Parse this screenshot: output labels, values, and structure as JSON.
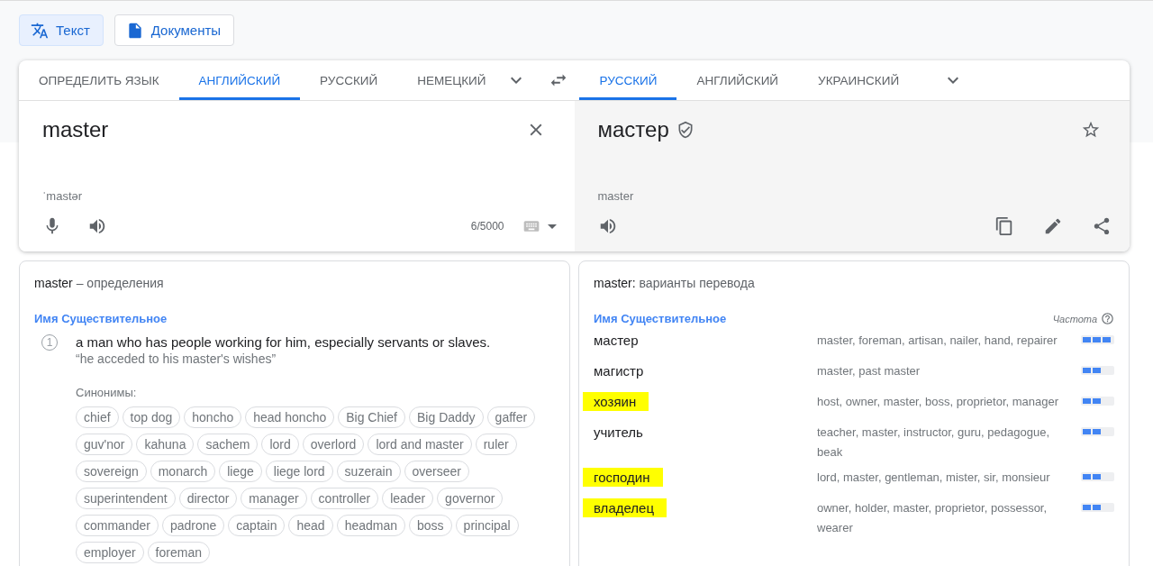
{
  "mode_buttons": [
    {
      "label": "Текст",
      "kind": "text",
      "selected": true
    },
    {
      "label": "Документы",
      "kind": "document",
      "selected": false
    }
  ],
  "source_tabs": [
    {
      "label": "ОПРЕДЕЛИТЬ ЯЗЫК",
      "selected": false
    },
    {
      "label": "АНГЛИЙСКИЙ",
      "selected": true
    },
    {
      "label": "РУССКИЙ",
      "selected": false
    },
    {
      "label": "НЕМЕЦКИЙ",
      "selected": false
    }
  ],
  "target_tabs": [
    {
      "label": "РУССКИЙ",
      "selected": true
    },
    {
      "label": "АНГЛИЙСКИЙ",
      "selected": false
    },
    {
      "label": "УКРАИНСКИЙ",
      "selected": false
    }
  ],
  "source": {
    "value": "master",
    "transcription": "ˈmastər",
    "char_count": "6/5000"
  },
  "target": {
    "value": "мастер",
    "transliteration": "master"
  },
  "definitions": {
    "word": "master",
    "title": " – определения",
    "part_of_speech": "Имя Существительное",
    "items": [
      {
        "number": "1",
        "text": "a man who has people working for him, especially servants or slaves.",
        "example": "“he acceded to his master's wishes”",
        "synonyms_label": "Синонимы:",
        "synonyms": [
          "chief",
          "top dog",
          "honcho",
          "head honcho",
          "Big Chief",
          "Big Daddy",
          "gaffer",
          "guv'nor",
          "kahuna",
          "sachem",
          "lord",
          "overlord",
          "lord and master",
          "ruler",
          "sovereign",
          "monarch",
          "liege",
          "liege lord",
          "suzerain",
          "overseer",
          "superintendent",
          "director",
          "manager",
          "controller",
          "leader",
          "governor",
          "commander",
          "padrone",
          "captain",
          "head",
          "headman",
          "boss",
          "principal",
          "employer",
          "foreman"
        ]
      }
    ]
  },
  "translations": {
    "word": "master:",
    "title": " варианты перевода",
    "part_of_speech": "Имя Существительное",
    "frequency_label": "Частота",
    "rows": [
      {
        "word": "мастер",
        "back": "master, foreman, artisan, nailer, hand, repairer",
        "level": 1,
        "highlighted": false
      },
      {
        "word": "магистр",
        "back": "master, past master",
        "level": 0.67,
        "highlighted": false
      },
      {
        "word": "хозяин",
        "back": "host, owner, master, boss, proprietor, manager",
        "level": 0.67,
        "highlighted": true
      },
      {
        "word": "учитель",
        "back": "teacher, master, instructor, guru, pedagogue, beak",
        "level": 0.67,
        "highlighted": false
      },
      {
        "word": "господин",
        "back": "lord, master, gentleman, mister, sir, monsieur",
        "level": 0.67,
        "highlighted": true
      },
      {
        "word": "владелец",
        "back": "owner, holder, master, proprietor, possessor, wearer",
        "level": 0.67,
        "highlighted": true
      }
    ]
  }
}
